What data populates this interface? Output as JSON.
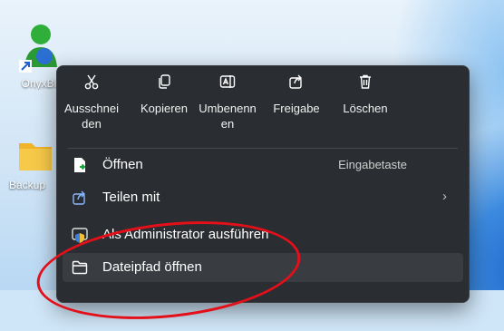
{
  "desktop": {
    "icons": [
      {
        "label": "OnyxBi",
        "name": "onyx-app-icon"
      },
      {
        "label": "Backup",
        "name": "backup-folder-icon"
      }
    ]
  },
  "context_menu": {
    "toolbar": [
      {
        "label": "Ausschnei den",
        "icon": "cut-icon"
      },
      {
        "label": "Kopieren",
        "icon": "copy-icon"
      },
      {
        "label": "Umbenenn en",
        "icon": "rename-icon"
      },
      {
        "label": "Freigabe",
        "icon": "share-icon"
      },
      {
        "label": "Löschen",
        "icon": "trash-icon"
      }
    ],
    "items": [
      {
        "label": "Öffnen",
        "shortcut": "Eingabetaste",
        "icon": "open-file-icon"
      },
      {
        "label": "Teilen mit",
        "icon": "share-icon",
        "has_submenu": true,
        "chevron": "›"
      },
      {
        "label": "Als Administrator ausführen",
        "icon": "admin-shield-icon"
      },
      {
        "label": "Dateipfad öffnen",
        "icon": "folder-icon",
        "highlighted": true
      }
    ]
  },
  "annotation": {
    "shape": "red-ellipse",
    "color": "#e3101a"
  }
}
